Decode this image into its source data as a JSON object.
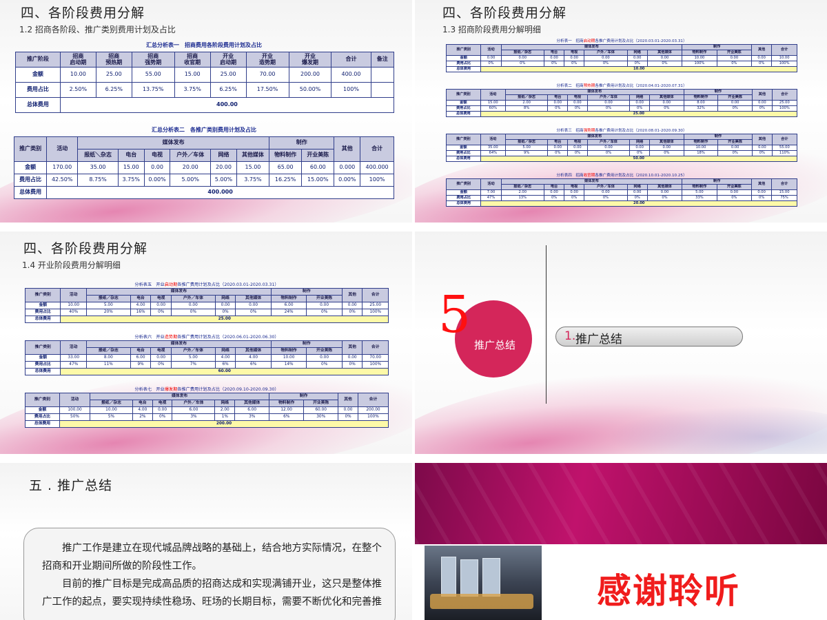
{
  "slide1": {
    "title": "四、各阶段费用分解",
    "subtitle": "1.2 招商各阶段、推广类别费用计划及占比",
    "table1": {
      "caption": "汇总分析表一　招商费用各阶段费用计划及占比",
      "headers": [
        "推广阶段",
        "招商\n启动期",
        "招商\n预热期",
        "招商\n强势期",
        "招商\n收官期",
        "开业\n启动期",
        "开业\n造势期",
        "开业\n爆发期",
        "合计",
        "备注"
      ],
      "rows": [
        [
          "金额",
          "10.00",
          "25.00",
          "55.00",
          "15.00",
          "25.00",
          "70.00",
          "200.00",
          "400.00",
          ""
        ],
        [
          "费用占比",
          "2.50%",
          "6.25%",
          "13.75%",
          "3.75%",
          "6.25%",
          "17.50%",
          "50.00%",
          "100%",
          ""
        ]
      ],
      "total_label": "总体费用",
      "total": "400.00"
    },
    "table2": {
      "caption": "汇总分析表二　各推广类别费用计划及占比",
      "h_type": "推广类别",
      "h_act": "活动",
      "h_media": "媒体发布",
      "h_make": "制作",
      "h_other": "其他",
      "h_sum": "合计",
      "sub": [
        "报纸＼杂志",
        "电台",
        "电视",
        "户外／车体",
        "网络",
        "其他媒体",
        "物料制作",
        "开业美陈"
      ],
      "rows": [
        [
          "金额",
          "170.00",
          "35.00",
          "15.00",
          "0.00",
          "20.00",
          "20.00",
          "15.00",
          "65.00",
          "60.00",
          "0.000",
          "400.000"
        ],
        [
          "费用占比",
          "42.50%",
          "8.75%",
          "3.75%",
          "0.00%",
          "5.00%",
          "5.00%",
          "3.75%",
          "16.25%",
          "15.00%",
          "0.00%",
          "100%"
        ]
      ],
      "total_label": "总体费用",
      "total": "400.000"
    }
  },
  "slide2": {
    "title": "四、各阶段费用分解",
    "subtitle": "1.3 招商阶段费用分解明细",
    "tables": [
      {
        "cap_a": "分析表一　招商",
        "cap_r": "启动期",
        "cap_b": "各推广费用计划及占比（2020.03.01-2020.03.31）",
        "r1": [
          "金额",
          "0.00",
          "0.00",
          "0.00",
          "0.00",
          "0.00",
          "0.00",
          "0.00",
          "10.00",
          "0.00",
          "0.00",
          "10.00"
        ],
        "r2": [
          "费用占比",
          "0%",
          "0%",
          "0%",
          "0%",
          "0%",
          "0%",
          "0%",
          "100%",
          "0%",
          "0%",
          "100%"
        ],
        "total": "10.00"
      },
      {
        "cap_a": "分析表二　招商",
        "cap_r": "预热期",
        "cap_b": "各推广费用计划及占比（2020.04.01-2020.07.31）",
        "r1": [
          "金额",
          "15.00",
          "2.00",
          "0.00",
          "0.00",
          "0.00",
          "0.00",
          "0.00",
          "8.00",
          "0.00",
          "0.00",
          "25.00"
        ],
        "r2": [
          "费用占比",
          "60%",
          "8%",
          "0%",
          "0%",
          "0%",
          "0%",
          "0%",
          "32%",
          "0%",
          "0%",
          "100%"
        ],
        "total": "25.00"
      },
      {
        "cap_a": "分析表三　招商",
        "cap_r": "强势期",
        "cap_b": "各推广费用计划及占比（2020.08.01-2020.09.30）",
        "r1": [
          "金额",
          "35.00",
          "5.00",
          "0.00",
          "0.00",
          "0.00",
          "0.00",
          "0.00",
          "10.00",
          "0.00",
          "0.00",
          "55.00"
        ],
        "r2": [
          "费用占比",
          "64%",
          "9%",
          "0%",
          "0%",
          "0%",
          "0%",
          "0%",
          "18%",
          "0%",
          "0%",
          "110%"
        ],
        "total": "50.00"
      },
      {
        "cap_a": "分析表四　招商",
        "cap_r": "收官期",
        "cap_b": "各推广费用计划及占比（2020.10.01-2020.10.25）",
        "r1": [
          "金额",
          "7.00",
          "2.00",
          "0.00",
          "0.00",
          "0.00",
          "0.00",
          "0.00",
          "5.00",
          "0.00",
          "0.00",
          "15.00"
        ],
        "r2": [
          "费用占比",
          "47%",
          "13%",
          "0%",
          "0%",
          "0%",
          "0%",
          "0%",
          "33%",
          "0%",
          "0%",
          "75%"
        ],
        "total": "20.00"
      }
    ]
  },
  "slide3": {
    "title": "四、各阶段费用分解",
    "subtitle": "1.4 开业阶段费用分解明细",
    "tables": [
      {
        "cap_a": "分析表五　开业",
        "cap_r": "启动期",
        "cap_b": "各推广费用计划及占比（2020.03.01-2020.03.31）",
        "r1": [
          "金额",
          "10.00",
          "5.00",
          "4.00",
          "0.00",
          "0.00",
          "0.00",
          "0.00",
          "6.00",
          "0.00",
          "0.00",
          "25.00"
        ],
        "r2": [
          "费用占比",
          "40%",
          "20%",
          "16%",
          "0%",
          "0%",
          "0%",
          "0%",
          "24%",
          "0%",
          "0%",
          "100%"
        ],
        "total": "25.00"
      },
      {
        "cap_a": "分析表六　开业",
        "cap_r": "造势期",
        "cap_b": "各推广费用计划及占比（2020.06.01-2020.06.30）",
        "r1": [
          "金额",
          "33.00",
          "8.00",
          "6.00",
          "0.00",
          "5.00",
          "4.00",
          "4.00",
          "10.00",
          "0.00",
          "0.00",
          "70.00"
        ],
        "r2": [
          "费用占比",
          "47%",
          "11%",
          "9%",
          "0%",
          "7%",
          "6%",
          "6%",
          "14%",
          "0%",
          "0%",
          "100%"
        ],
        "total": "60.00"
      },
      {
        "cap_a": "分析表七　开业",
        "cap_r": "爆发期",
        "cap_b": "各推广费用计划及占比（2020.09.10-2020.09.30）",
        "r1": [
          "金额",
          "100.00",
          "10.00",
          "4.00",
          "0.00",
          "6.00",
          "2.00",
          "6.00",
          "12.00",
          "60.00",
          "0.00",
          "200.00"
        ],
        "r2": [
          "费用占比",
          "50%",
          "5%",
          "2%",
          "0%",
          "3%",
          "1%",
          "3%",
          "6%",
          "30%",
          "0%",
          "100%"
        ],
        "total": "200.00"
      }
    ]
  },
  "mini_header": {
    "h_type": "推广类别",
    "h_act": "活动",
    "h_media": "媒体发布",
    "h_make": "制作",
    "h_other": "其他",
    "h_sum": "合计",
    "total_label": "总体费用",
    "sub": [
      "报纸／杂志",
      "电台",
      "电视",
      "户外／车体",
      "网络",
      "其他媒体",
      "物料制作",
      "开业美陈"
    ]
  },
  "slide4": {
    "number": "5",
    "circle_text": "推广总结",
    "pill_num": "1.",
    "pill_text": "推广总结"
  },
  "slide5": {
    "title": "五 . 推广总结",
    "para1": "推广工作是建立在现代城品牌战略的基础上，结合地方实际情况，在整个招商和开业期间所做的阶段性工作。",
    "para2": "目前的推广目标是完成高品质的招商达成和实现满铺开业，这只是整体推广工作的起点，要实现持续性稳场、旺场的长期目标，需要不断优化和完善推"
  },
  "slide6": {
    "thanks": "感谢聆听"
  }
}
